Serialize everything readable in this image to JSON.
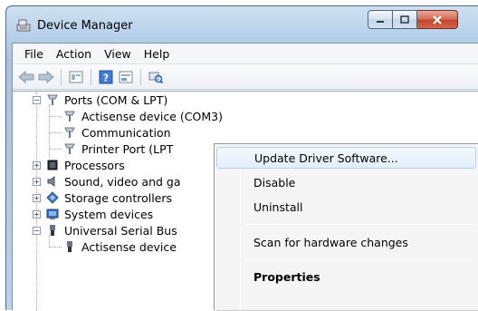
{
  "window": {
    "title": "Device Manager"
  },
  "menubar": {
    "items": [
      "File",
      "Action",
      "View",
      "Help"
    ]
  },
  "toolbar": {
    "icons": [
      "back-arrow-icon",
      "forward-arrow-icon",
      "properties-icon",
      "help-icon",
      "update-driver-icon",
      "scan-hardware-icon"
    ]
  },
  "tree": {
    "ports": "Ports (COM & LPT)",
    "port_children": [
      "Actisense device (COM3)",
      "Communication",
      "Printer Port (LPT"
    ],
    "others": [
      "Processors",
      "Sound, video and ga",
      "Storage controllers",
      "System devices",
      "Universal Serial Bus"
    ],
    "usb_child": "Actisense device"
  },
  "context_menu": {
    "items": [
      "Update Driver Software...",
      "Disable",
      "Uninstall",
      "Scan for hardware changes",
      "Properties"
    ]
  }
}
